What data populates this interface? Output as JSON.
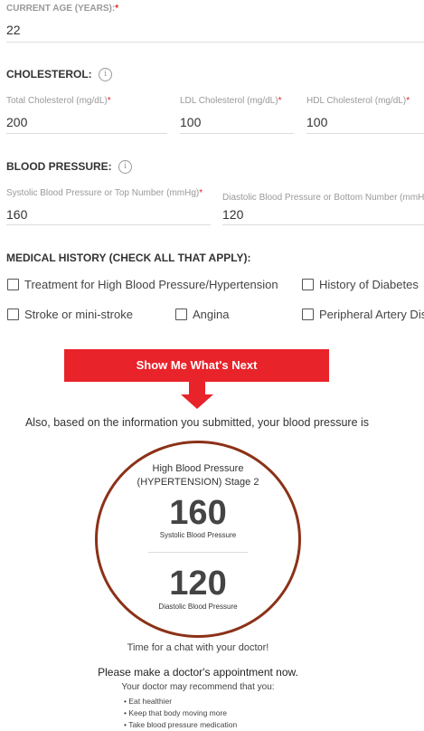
{
  "age": {
    "label": "CURRENT AGE (YEARS):",
    "required_mark": "*",
    "value": "22"
  },
  "cholesterol": {
    "label": "CHOLESTEROL:",
    "info_glyph": "i",
    "fields": [
      {
        "label": "Total Cholesterol (mg/dL)",
        "required_mark": "*",
        "value": "200"
      },
      {
        "label": "LDL Cholesterol (mg/dL)",
        "required_mark": "*",
        "value": "100"
      },
      {
        "label": "HDL Cholesterol (mg/dL)",
        "required_mark": "*",
        "value": "100"
      }
    ]
  },
  "blood_pressure": {
    "label": "BLOOD PRESSURE:",
    "info_glyph": "i",
    "fields": [
      {
        "label": "Systolic Blood Pressure or Top Number (mmHg)",
        "required_mark": "*",
        "value": "160"
      },
      {
        "label": "Diastolic Blood Pressure or Bottom Number (mmHg)",
        "value": "120"
      }
    ]
  },
  "medical_history": {
    "label": "MEDICAL HISTORY (CHECK ALL THAT APPLY):",
    "options": [
      "Treatment for High Blood Pressure/Hypertension",
      "History of Diabetes",
      "Stroke or mini-stroke",
      "Angina",
      "Peripheral Artery Disease"
    ]
  },
  "cta": {
    "label": "Show Me What's Next"
  },
  "result": {
    "intro": "Also, based on the information you submitted, your blood pressure is",
    "category_line1": "High Blood Pressure",
    "category_line2": "(HYPERTENSION) Stage 2",
    "systolic_value": "160",
    "systolic_label": "Systolic Blood Pressure",
    "diastolic_value": "120",
    "diastolic_label": "Diastolic Blood Pressure",
    "chat_text": "Time for a chat with your doctor!",
    "appointment_text": "Please make a doctor's appointment now.",
    "recommend_intro": "Your doctor may recommend that you:",
    "recommendations": [
      "Eat healthier",
      "Keep that body moving more",
      "Take blood pressure medication"
    ]
  },
  "colors": {
    "accent": "#e8232a",
    "circle": "#8b3218"
  }
}
